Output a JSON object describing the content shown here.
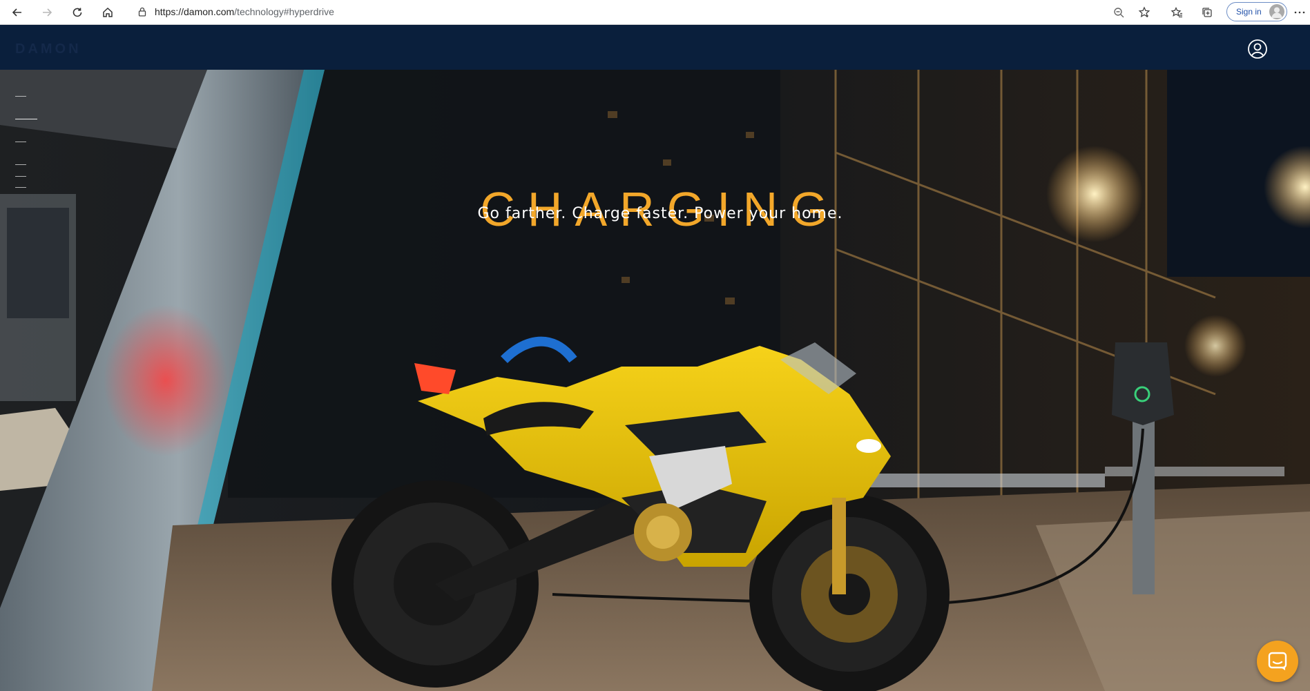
{
  "browser": {
    "url_host": "https://damon.com",
    "url_path": "/technology#hyperdrive",
    "signin_label": "Sign in",
    "icons": [
      "back-arrow-icon",
      "forward-arrow-icon",
      "reload-icon",
      "home-icon",
      "lock-icon",
      "zoom-out-icon",
      "add-favorite-icon",
      "favorites-icon",
      "collections-icon",
      "more-icon"
    ]
  },
  "site": {
    "logo_text": "DAMON",
    "account_icon": "user-circle-icon"
  },
  "hero": {
    "title": "CHARGING",
    "subtitle": "Go farther. Charge faster. Power your home.",
    "side_nav_count": 6,
    "side_nav_active_index": 1,
    "accent_color": "#f2a72a"
  },
  "chat": {
    "icon": "chat-bubble-icon",
    "color": "#f4a21f"
  }
}
